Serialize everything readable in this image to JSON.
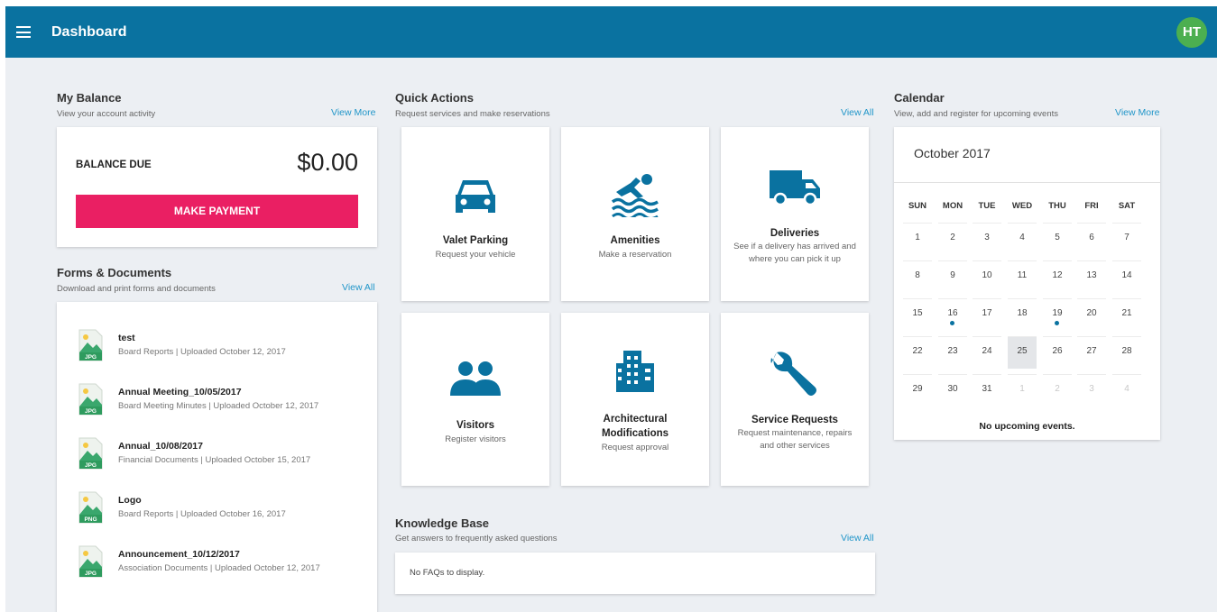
{
  "header": {
    "title": "Dashboard",
    "avatar_initials": "HT",
    "bar_color": "#0a72a0"
  },
  "balance": {
    "title": "My Balance",
    "subtitle": "View your account activity",
    "link": "View More",
    "label": "BALANCE DUE",
    "amount": "$0.00",
    "button": "MAKE PAYMENT",
    "button_color": "#ea1f63"
  },
  "forms": {
    "title": "Forms & Documents",
    "subtitle": "Download and print forms and documents",
    "link": "View All",
    "items": [
      {
        "name": "test",
        "meta": "Board Reports | Uploaded October 12, 2017",
        "type": "JPG"
      },
      {
        "name": "Annual Meeting_10/05/2017",
        "meta": "Board Meeting Minutes | Uploaded October 12, 2017",
        "type": "JPG"
      },
      {
        "name": "Annual_10/08/2017",
        "meta": "Financial Documents | Uploaded October 15, 2017",
        "type": "JPG"
      },
      {
        "name": "Logo",
        "meta": "Board Reports | Uploaded October 16, 2017",
        "type": "PNG"
      },
      {
        "name": "Announcement_10/12/2017",
        "meta": "Association Documents | Uploaded October 12, 2017",
        "type": "JPG"
      }
    ]
  },
  "quick_actions": {
    "title": "Quick Actions",
    "subtitle": "Request services and make reservations",
    "link": "View All",
    "icon_color": "#0a72a0",
    "items": [
      {
        "title": "Valet Parking",
        "sub": "Request your vehicle",
        "icon": "car-icon"
      },
      {
        "title": "Amenities",
        "sub": "Make a reservation",
        "icon": "swimmer-icon"
      },
      {
        "title": "Deliveries",
        "sub": "See if a delivery has arrived and where you can pick it up",
        "icon": "truck-icon"
      },
      {
        "title": "Visitors",
        "sub": "Register visitors",
        "icon": "people-icon"
      },
      {
        "title": "Architectural Modifications",
        "sub": "Request approval",
        "icon": "building-icon"
      },
      {
        "title": "Service Requests",
        "sub": "Request maintenance, repairs and other services",
        "icon": "wrench-icon"
      }
    ]
  },
  "knowledge": {
    "title": "Knowledge Base",
    "subtitle": "Get answers to frequently asked questions",
    "link": "View All",
    "empty": "No FAQs to display."
  },
  "calendar": {
    "title": "Calendar",
    "subtitle": "View, add and register for upcoming events",
    "link": "View More",
    "month": "October 2017",
    "weekdays": [
      "SUN",
      "MON",
      "TUE",
      "WED",
      "THU",
      "FRI",
      "SAT"
    ],
    "weeks": [
      [
        "1",
        "2",
        "3",
        "4",
        "5",
        "6",
        "7"
      ],
      [
        "8",
        "9",
        "10",
        "11",
        "12",
        "13",
        "14"
      ],
      [
        "15",
        "16",
        "17",
        "18",
        "19",
        "20",
        "21"
      ],
      [
        "22",
        "23",
        "24",
        "25",
        "26",
        "27",
        "28"
      ],
      [
        "29",
        "30",
        "31",
        "1",
        "2",
        "3",
        "4"
      ]
    ],
    "today": "25",
    "event_days": [
      "16",
      "19"
    ],
    "next_month_days": [
      "1",
      "2",
      "3",
      "4"
    ],
    "empty": "No upcoming events."
  }
}
